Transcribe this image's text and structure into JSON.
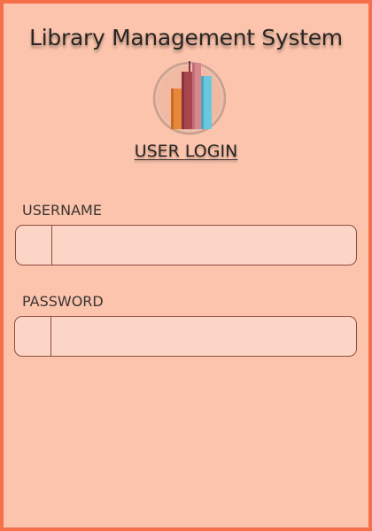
{
  "app": {
    "title": "Library Management System"
  },
  "logo": {
    "icon": "books-icon"
  },
  "login": {
    "heading": "USER LOGIN",
    "username": {
      "label": "USERNAME",
      "value": "",
      "placeholder": ""
    },
    "password": {
      "label": "PASSWORD",
      "value": "",
      "placeholder": ""
    }
  },
  "colors": {
    "background": "#fcc4ac",
    "border": "#f5704a",
    "field_background": "#fdd5c6",
    "field_border": "#8a4e3e",
    "text": "#2a2624"
  }
}
